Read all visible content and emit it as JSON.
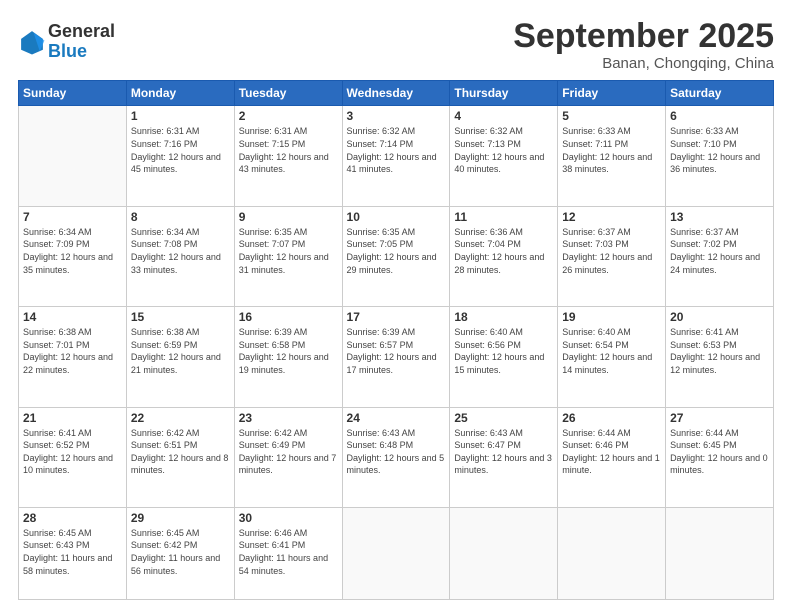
{
  "logo": {
    "line1": "General",
    "line2": "Blue"
  },
  "title": "September 2025",
  "subtitle": "Banan, Chongqing, China",
  "days_of_week": [
    "Sunday",
    "Monday",
    "Tuesday",
    "Wednesday",
    "Thursday",
    "Friday",
    "Saturday"
  ],
  "weeks": [
    [
      {
        "day": "",
        "info": ""
      },
      {
        "day": "1",
        "info": "Sunrise: 6:31 AM\nSunset: 7:16 PM\nDaylight: 12 hours\nand 45 minutes."
      },
      {
        "day": "2",
        "info": "Sunrise: 6:31 AM\nSunset: 7:15 PM\nDaylight: 12 hours\nand 43 minutes."
      },
      {
        "day": "3",
        "info": "Sunrise: 6:32 AM\nSunset: 7:14 PM\nDaylight: 12 hours\nand 41 minutes."
      },
      {
        "day": "4",
        "info": "Sunrise: 6:32 AM\nSunset: 7:13 PM\nDaylight: 12 hours\nand 40 minutes."
      },
      {
        "day": "5",
        "info": "Sunrise: 6:33 AM\nSunset: 7:11 PM\nDaylight: 12 hours\nand 38 minutes."
      },
      {
        "day": "6",
        "info": "Sunrise: 6:33 AM\nSunset: 7:10 PM\nDaylight: 12 hours\nand 36 minutes."
      }
    ],
    [
      {
        "day": "7",
        "info": "Sunrise: 6:34 AM\nSunset: 7:09 PM\nDaylight: 12 hours\nand 35 minutes."
      },
      {
        "day": "8",
        "info": "Sunrise: 6:34 AM\nSunset: 7:08 PM\nDaylight: 12 hours\nand 33 minutes."
      },
      {
        "day": "9",
        "info": "Sunrise: 6:35 AM\nSunset: 7:07 PM\nDaylight: 12 hours\nand 31 minutes."
      },
      {
        "day": "10",
        "info": "Sunrise: 6:35 AM\nSunset: 7:05 PM\nDaylight: 12 hours\nand 29 minutes."
      },
      {
        "day": "11",
        "info": "Sunrise: 6:36 AM\nSunset: 7:04 PM\nDaylight: 12 hours\nand 28 minutes."
      },
      {
        "day": "12",
        "info": "Sunrise: 6:37 AM\nSunset: 7:03 PM\nDaylight: 12 hours\nand 26 minutes."
      },
      {
        "day": "13",
        "info": "Sunrise: 6:37 AM\nSunset: 7:02 PM\nDaylight: 12 hours\nand 24 minutes."
      }
    ],
    [
      {
        "day": "14",
        "info": "Sunrise: 6:38 AM\nSunset: 7:01 PM\nDaylight: 12 hours\nand 22 minutes."
      },
      {
        "day": "15",
        "info": "Sunrise: 6:38 AM\nSunset: 6:59 PM\nDaylight: 12 hours\nand 21 minutes."
      },
      {
        "day": "16",
        "info": "Sunrise: 6:39 AM\nSunset: 6:58 PM\nDaylight: 12 hours\nand 19 minutes."
      },
      {
        "day": "17",
        "info": "Sunrise: 6:39 AM\nSunset: 6:57 PM\nDaylight: 12 hours\nand 17 minutes."
      },
      {
        "day": "18",
        "info": "Sunrise: 6:40 AM\nSunset: 6:56 PM\nDaylight: 12 hours\nand 15 minutes."
      },
      {
        "day": "19",
        "info": "Sunrise: 6:40 AM\nSunset: 6:54 PM\nDaylight: 12 hours\nand 14 minutes."
      },
      {
        "day": "20",
        "info": "Sunrise: 6:41 AM\nSunset: 6:53 PM\nDaylight: 12 hours\nand 12 minutes."
      }
    ],
    [
      {
        "day": "21",
        "info": "Sunrise: 6:41 AM\nSunset: 6:52 PM\nDaylight: 12 hours\nand 10 minutes."
      },
      {
        "day": "22",
        "info": "Sunrise: 6:42 AM\nSunset: 6:51 PM\nDaylight: 12 hours\nand 8 minutes."
      },
      {
        "day": "23",
        "info": "Sunrise: 6:42 AM\nSunset: 6:49 PM\nDaylight: 12 hours\nand 7 minutes."
      },
      {
        "day": "24",
        "info": "Sunrise: 6:43 AM\nSunset: 6:48 PM\nDaylight: 12 hours\nand 5 minutes."
      },
      {
        "day": "25",
        "info": "Sunrise: 6:43 AM\nSunset: 6:47 PM\nDaylight: 12 hours\nand 3 minutes."
      },
      {
        "day": "26",
        "info": "Sunrise: 6:44 AM\nSunset: 6:46 PM\nDaylight: 12 hours\nand 1 minute."
      },
      {
        "day": "27",
        "info": "Sunrise: 6:44 AM\nSunset: 6:45 PM\nDaylight: 12 hours\nand 0 minutes."
      }
    ],
    [
      {
        "day": "28",
        "info": "Sunrise: 6:45 AM\nSunset: 6:43 PM\nDaylight: 11 hours\nand 58 minutes."
      },
      {
        "day": "29",
        "info": "Sunrise: 6:45 AM\nSunset: 6:42 PM\nDaylight: 11 hours\nand 56 minutes."
      },
      {
        "day": "30",
        "info": "Sunrise: 6:46 AM\nSunset: 6:41 PM\nDaylight: 11 hours\nand 54 minutes."
      },
      {
        "day": "",
        "info": ""
      },
      {
        "day": "",
        "info": ""
      },
      {
        "day": "",
        "info": ""
      },
      {
        "day": "",
        "info": ""
      }
    ]
  ]
}
